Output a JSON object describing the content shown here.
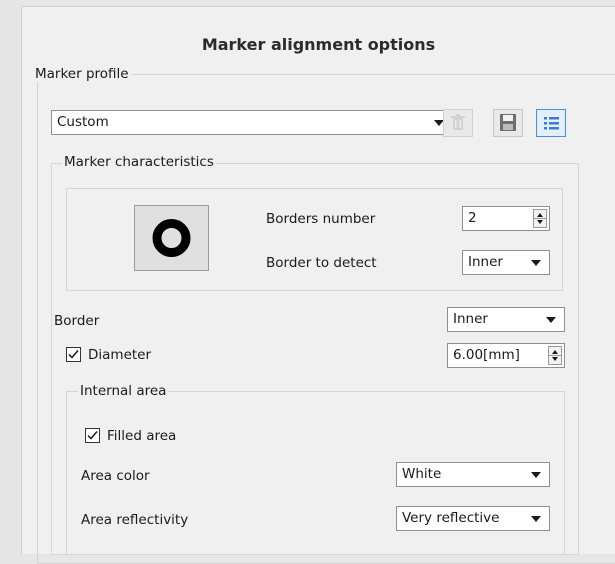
{
  "dialog": {
    "title": "Marker alignment options"
  },
  "marker_profile": {
    "legend": "Marker profile",
    "selected": "Custom",
    "buttons": {
      "delete_icon": "trash-icon",
      "save_icon": "floppy-disk-icon",
      "list_icon": "list-icon"
    }
  },
  "marker_characteristics": {
    "legend": "Marker characteristics",
    "borders_number_label": "Borders number",
    "borders_number_value": "2",
    "border_to_detect_label": "Border to detect",
    "border_to_detect_value": "Inner"
  },
  "border": {
    "label": "Border",
    "value": "Inner"
  },
  "diameter": {
    "label": "Diameter",
    "checked": true,
    "value": "6.00[mm]"
  },
  "internal_area": {
    "legend": "Internal area",
    "filled_label": "Filled area",
    "filled_checked": true,
    "area_color_label": "Area color",
    "area_color_value": "White",
    "area_reflectivity_label": "Area reflectivity",
    "area_reflectivity_value": "Very reflective"
  },
  "colors": {
    "accent": "#4a90d9",
    "panel": "#f0f0f0",
    "disabled": "#c8c8c8"
  }
}
